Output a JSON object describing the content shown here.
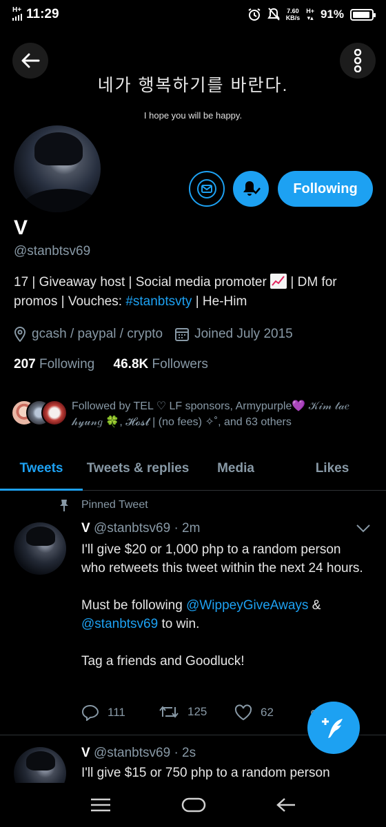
{
  "status_bar": {
    "signal": "H+",
    "time": "11:29",
    "net_speed_value": "7.60",
    "net_speed_unit": "KB/s",
    "network": "H+",
    "battery": "91%",
    "battery_level": 0.91
  },
  "banner": {
    "korean_text": "네가 행복하기를 바란다.",
    "english_text": "I hope you will be happy."
  },
  "profile": {
    "follow_label": "Following",
    "name": "V",
    "handle": "@stanbtsv69",
    "bio_part1": "17 | Giveaway host | Social media promoter",
    "bio_part2": "| DM for promos | Vouches:",
    "bio_hashtag": "#stanbtsvty",
    "bio_part3": "| He-Him",
    "location": "gcash / paypal / crypto",
    "joined": "Joined July 2015",
    "following_count": "207",
    "following_label": "Following",
    "followers_count": "46.8K",
    "followers_label": "Followers",
    "followed_by_1": "Followed by TEL ♡ LF sponsors, Armypurple",
    "followed_by_heart": "💜",
    "followed_by_2": "𝒦𝒾𝓂 𝓉𝒶𝑒 𝒽𝓎𝓊𝓃𝑔",
    "followed_by_clover": "🍀",
    "followed_by_3": ", 𝓗𝓸𝓼𝓽 | (no fees) ✧˚, and 63 others"
  },
  "tabs": [
    {
      "label": "Tweets",
      "active": true
    },
    {
      "label": "Tweets & replies",
      "active": false
    },
    {
      "label": "Media",
      "active": false
    },
    {
      "label": "Likes",
      "active": false
    }
  ],
  "tweets": [
    {
      "pinned_label": "Pinned Tweet",
      "name": "V",
      "handle": "@stanbtsv69",
      "time": "· 2m",
      "line1": "I'll give $20 or 1,000 php to a random person who retweets this tweet within the next 24 hours.",
      "line2_pre": "Must be following",
      "mention1": "@WippeyGiveAways",
      "line2_mid": "&",
      "mention2": "@stanbtsv69",
      "line2_post": "to win.",
      "line3": "Tag a friends and Goodluck!",
      "replies": "111",
      "retweets": "125",
      "likes": "62"
    },
    {
      "name": "V",
      "handle": "@stanbtsv69",
      "time": "· 2s",
      "line1": "I'll give $15 or 750 php to a random person"
    }
  ],
  "colors": {
    "accent": "#1da1f2",
    "background": "#000000",
    "secondary_text": "#8899a6"
  }
}
